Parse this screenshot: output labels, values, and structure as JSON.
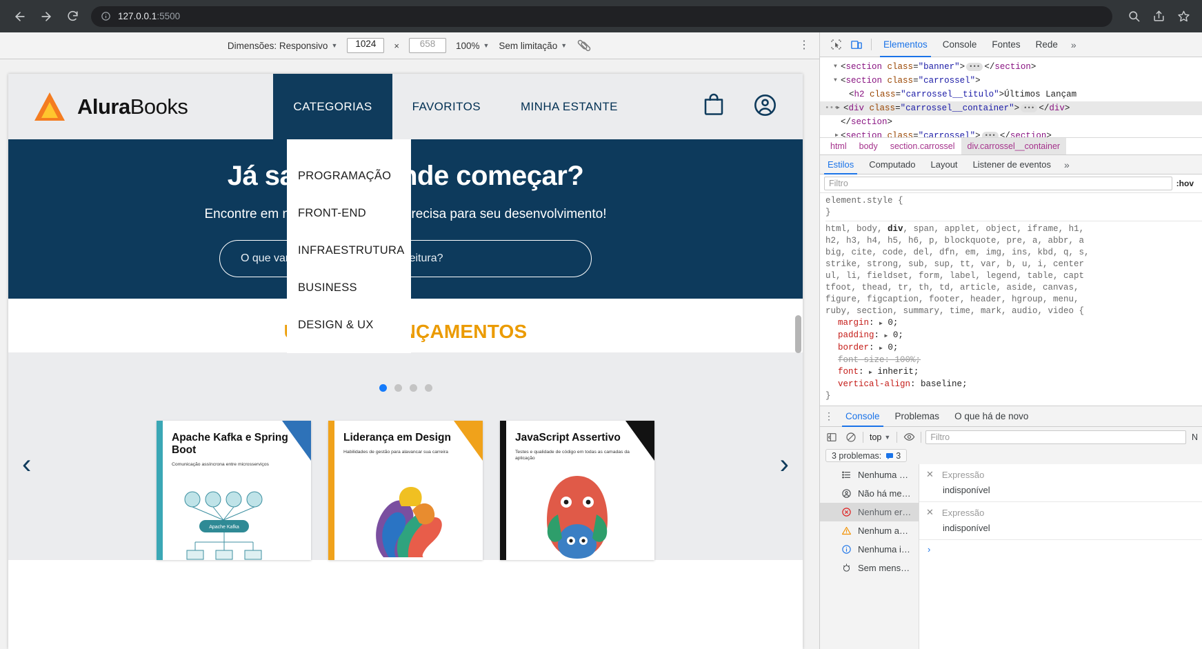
{
  "browser": {
    "back_icon": "back-arrow-icon",
    "forward_icon": "forward-arrow-icon",
    "reload_icon": "reload-icon",
    "site_info_icon": "info-circle-icon",
    "url_host": "127.0.0.1",
    "url_port": ":5500",
    "zoom_icon": "zoom-search-icon",
    "share_icon": "share-icon",
    "bookmark_icon": "star-icon"
  },
  "device_toolbar": {
    "dimensions_label": "Dimensões: Responsivo",
    "width_value": "1024",
    "times": "×",
    "height_value": "658",
    "zoom_value": "100%",
    "throttling_label": "Sem limitação",
    "rotate_icon": "rotate-device-icon",
    "menu_icon": "kebab-menu-icon"
  },
  "site": {
    "brand_bold": "Alura",
    "brand_thin": "Books",
    "logo_icon": "alura-triangle-logo",
    "nav": [
      {
        "label": "CATEGORIAS",
        "active": true
      },
      {
        "label": "FAVORITOS",
        "active": false
      },
      {
        "label": "MINHA ESTANTE",
        "active": false
      }
    ],
    "cart_icon": "shopping-bag-icon",
    "account_icon": "user-account-icon",
    "dropdown": [
      "PROGRAMAÇÃO",
      "FRONT-END",
      "INFRAESTRUTURA",
      "BUSINESS",
      "DESIGN & UX"
    ],
    "banner": {
      "heading": "Já sabe por onde começar?",
      "subheading": "Encontre em nossa estante o que precisa para seu desenvolvimento!",
      "search_placeholder": "O que vamos estudar na próxima leitura?"
    },
    "carousel": {
      "title": "ÚLTIMOS LANÇAMENTOS",
      "prev_arrow": "‹",
      "next_arrow": "›",
      "dots_total": 4,
      "active_dot": 0,
      "books": [
        {
          "title": "Apache Kafka e Spring Boot",
          "subtitle": "Comunicação assíncrona entre microsserviços",
          "accent": "#3aa7b5",
          "corner": "#2e72b8",
          "art": "kafka"
        },
        {
          "title": "Liderança em Design",
          "subtitle": "Habilidades de gestão para alavancar sua carreira",
          "accent": "#f0a21b",
          "corner": "#f0a21b",
          "art": "liderança"
        },
        {
          "title": "JavaScript Assertivo",
          "subtitle": "Testes e qualidade de código em todas as camadas da aplicação",
          "accent": "#121212",
          "corner": "#121212",
          "art": "javascript"
        }
      ]
    }
  },
  "devtools": {
    "inspect_icon": "inspect-element-icon",
    "device_icon": "device-toolbar-icon",
    "tabs": [
      {
        "label": "Elementos",
        "active": true
      },
      {
        "label": "Console",
        "active": false
      },
      {
        "label": "Fontes",
        "active": false
      },
      {
        "label": "Rede",
        "active": false
      }
    ],
    "more_tabs": "»",
    "dom_lines": [
      {
        "indent": 1,
        "twisty": "▼",
        "text": "<section class=\"banner\"> … </section>",
        "selected": false,
        "partial": true
      },
      {
        "indent": 1,
        "twisty": "▼",
        "text": "<section class=\"carrossel\">",
        "selected": false
      },
      {
        "indent": 2,
        "twisty": "",
        "text": "<h2 class=\"carrossel__titulo\">Últimos Lançam",
        "selected": false
      },
      {
        "indent": 1,
        "twisty": "▶",
        "text": "<div class=\"carrossel__container\"> … </div>",
        "selected": true
      },
      {
        "indent": 1,
        "twisty": "",
        "text": "</section>",
        "selected": false
      },
      {
        "indent": 1,
        "twisty": "▶",
        "text": "<section class=\"carrossel\"> … </section>",
        "selected": false
      }
    ],
    "breadcrumbs": [
      {
        "label": "html",
        "active": false
      },
      {
        "label": "body",
        "active": false
      },
      {
        "label": "section.carrossel",
        "active": false
      },
      {
        "label": "div.carrossel__container",
        "active": true
      }
    ],
    "style_tabs": [
      {
        "label": "Estilos",
        "active": true
      },
      {
        "label": "Computado",
        "active": false
      },
      {
        "label": "Layout",
        "active": false
      },
      {
        "label": "Listener de eventos",
        "active": false
      }
    ],
    "style_more": "»",
    "filter_placeholder": "Filtro",
    "hov_label": ":hov",
    "css": {
      "element_style_selector": "element.style {",
      "element_style_close": "}",
      "reset_selector_lines": [
        "html, body, div, span, applet, object, iframe, h1,",
        "h2, h3, h4, h5, h6, p, blockquote, pre, a, abbr, a",
        "big, cite, code, del, dfn, em, img, ins, kbd, q, s,",
        "strike, strong, sub, sup, tt, var, b, u, i, center",
        "ul, li, fieldset, form, label, legend, table, capt",
        "tfoot, thead, tr, th, td, article, aside, canvas,",
        "figure, figcaption, footer, header, hgroup, menu,",
        "ruby, section, summary, time, mark, audio, video {"
      ],
      "declarations": [
        {
          "prop": "margin",
          "value": "0",
          "arrow": true,
          "struck": false
        },
        {
          "prop": "padding",
          "value": "0",
          "arrow": true,
          "struck": false
        },
        {
          "prop": "border",
          "value": "0",
          "arrow": true,
          "struck": false
        },
        {
          "prop": "font-size",
          "value": "100%",
          "arrow": false,
          "struck": true
        },
        {
          "prop": "font",
          "value": "inherit",
          "arrow": true,
          "struck": false
        },
        {
          "prop": "vertical-align",
          "value": "baseline",
          "arrow": false,
          "struck": false
        }
      ],
      "close_brace": "}"
    },
    "drawer": {
      "kebab_icon": "kebab-menu-icon",
      "tabs": [
        {
          "label": "Console",
          "active": true
        },
        {
          "label": "Problemas",
          "active": false
        },
        {
          "label": "O que há de novo",
          "active": false
        }
      ],
      "sidebar_toggle_icon": "show-console-sidebar-icon",
      "clear_icon": "clear-console-icon",
      "context_value": "top",
      "eye_icon": "live-expression-icon",
      "filter_placeholder": "Filtro",
      "levels_label": "N",
      "issues_text": "3 problemas:",
      "issues_count": "3",
      "issues_icon": "issue-message-icon",
      "messages": [
        {
          "icon": "list-icon",
          "label": "Nenhuma …",
          "selected": false
        },
        {
          "icon": "user-message-icon",
          "label": "Não há me…",
          "selected": false
        },
        {
          "icon": "error-icon",
          "label": "Nenhum er…",
          "selected": true
        },
        {
          "icon": "warning-icon",
          "label": "Nenhum a…",
          "selected": false
        },
        {
          "icon": "info-icon",
          "label": "Nenhuma i…",
          "selected": false
        },
        {
          "icon": "verbose-icon",
          "label": "Sem mens…",
          "selected": false
        }
      ],
      "expressions": [
        {
          "title": "Expressão",
          "value": "indisponível"
        },
        {
          "title": "Expressão",
          "value": "indisponível"
        }
      ],
      "prompt_symbol": "›"
    }
  }
}
